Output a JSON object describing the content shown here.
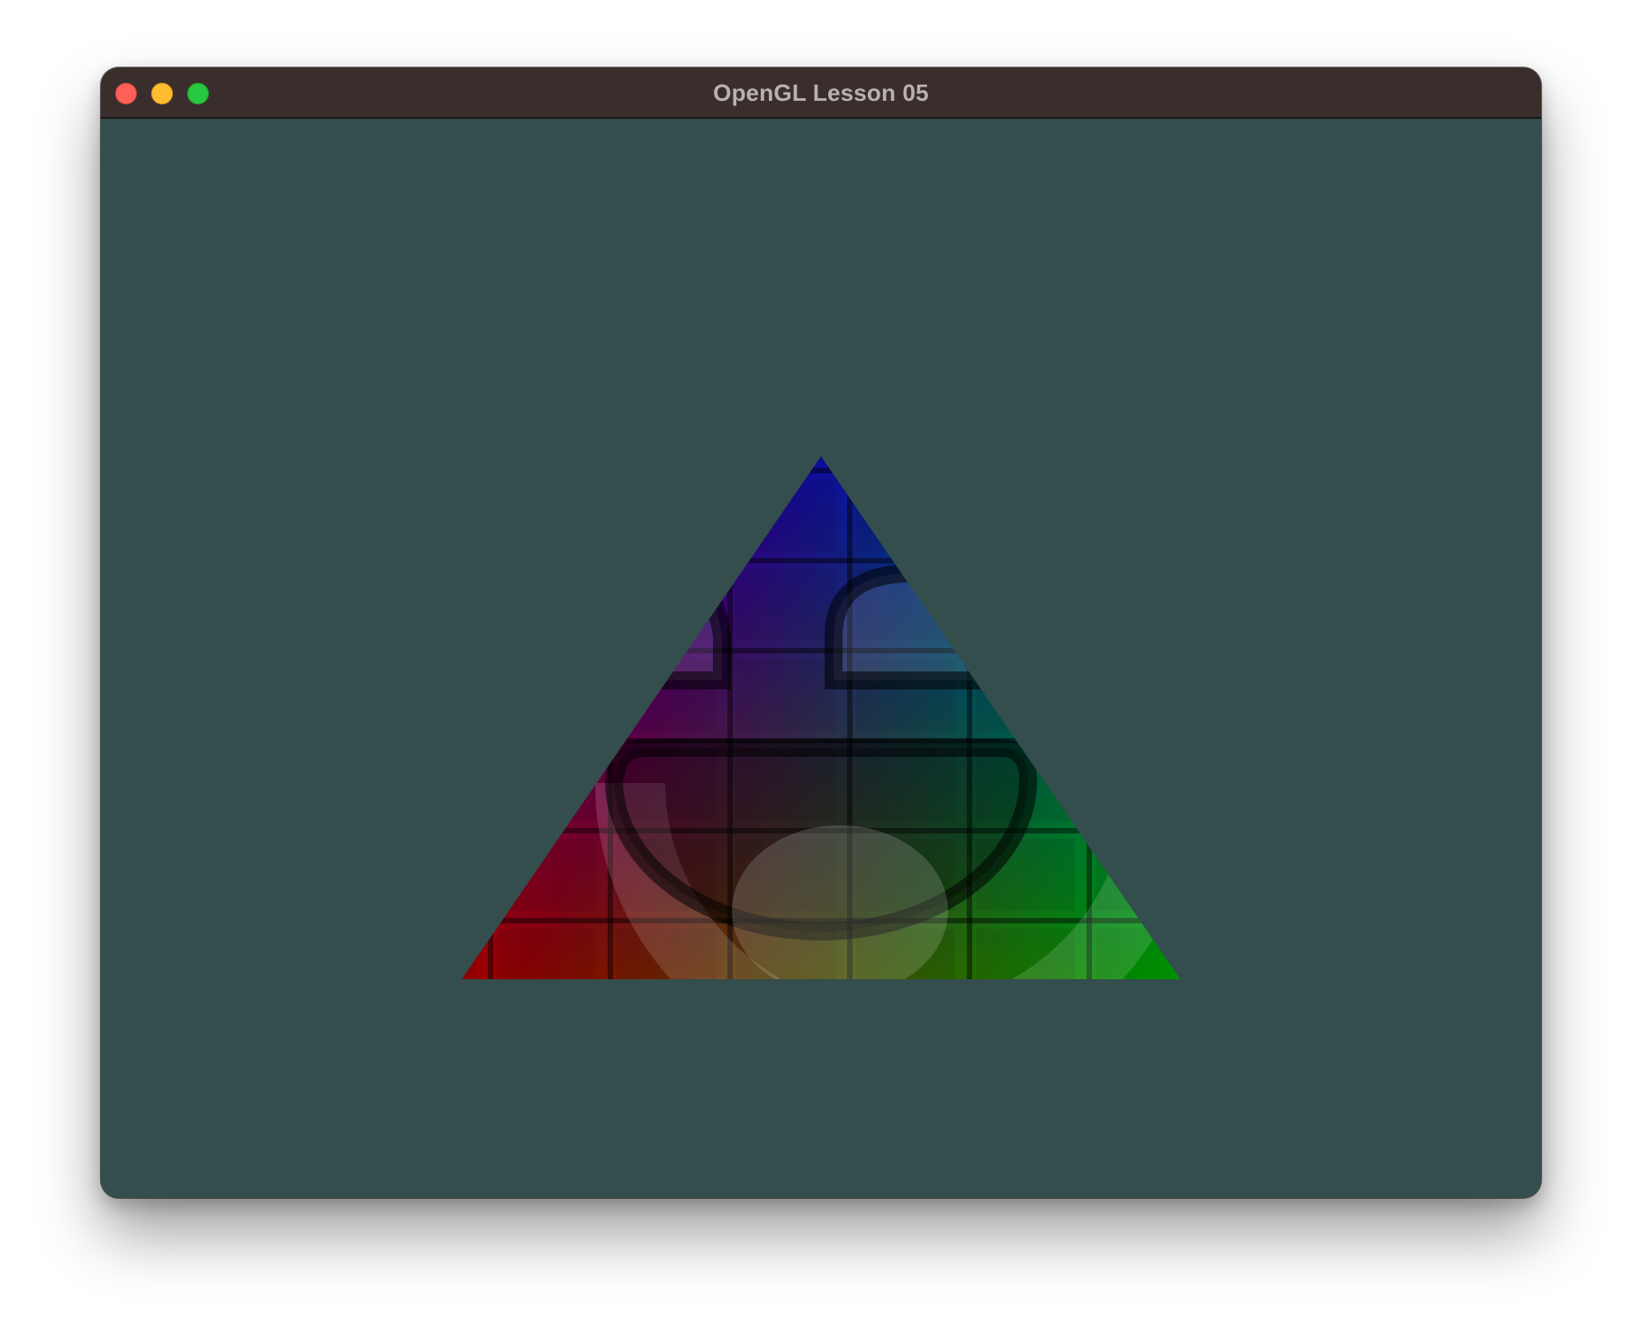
{
  "window": {
    "title": "OpenGL Lesson 05",
    "clear_color": "#344d4d",
    "titlebar_color": "#3a2e2d",
    "title_color": "#b9b1af"
  },
  "traffic_lights": {
    "close": "#fe5f57",
    "minimize": "#febc2e",
    "zoom": "#28c840"
  },
  "scene": {
    "primitive": "triangle",
    "vertex_colors": {
      "top": "#0000ff",
      "bottom_left": "#ff0000",
      "bottom_right": "#00ff00"
    },
    "textures": [
      "brick-wall",
      "awesome-face"
    ]
  }
}
